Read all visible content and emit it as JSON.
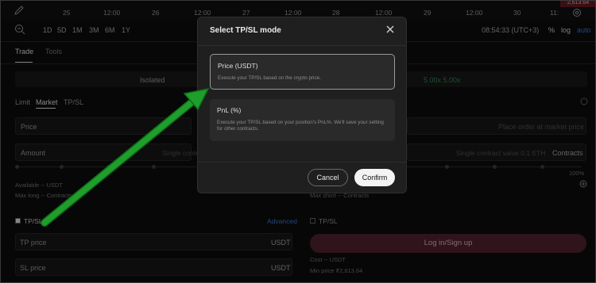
{
  "timeline": {
    "ticks": [
      "25",
      "12:00",
      "26",
      "12:00",
      "27",
      "12:00",
      "28",
      "12:00",
      "29",
      "12:00",
      "30",
      "11:"
    ],
    "price_tag": "2,613.64"
  },
  "toolbar": {
    "timeframes": [
      "1D",
      "5D",
      "1M",
      "3M",
      "6M",
      "1Y"
    ],
    "clock": "08:54:33 (UTC+3)",
    "percent_label": "%",
    "log_label": "log",
    "auto_label": "auto"
  },
  "panel": {
    "tabs": [
      "Trade",
      "Tools"
    ],
    "margin_mode": "Isolated",
    "leverage": "5.00x  5.00x",
    "order_types": [
      "Limit",
      "Market",
      "TP/SL"
    ],
    "price_label": "Price",
    "price_placeholder": "Place order at market price",
    "amount_label": "Amount",
    "amount_placeholder_left": "Single contr",
    "amount_placeholder_right": "Single contract value 0.1 ETH",
    "amount_unit": "Contracts",
    "pct_max": "100%",
    "available": "Available -- USDT",
    "max_long": "Max long -- Contracts",
    "max_short": "Max short -- Contracts",
    "tpsl_label_left": "TP/SL",
    "advanced": "Advanced",
    "tpsl_label_right": "TP/SL",
    "tp_price": "TP price",
    "sl_price": "SL price",
    "unit_usdt": "USDT",
    "login_button": "Log in/Sign up",
    "cost": "Cost -- USDT",
    "min_price": "Min price ₮2,613.64"
  },
  "modal": {
    "title": "Select TP/SL mode",
    "options": [
      {
        "title": "Price (USDT)",
        "desc": "Execute your TP/SL based on the crypto price."
      },
      {
        "title": "PnL (%)",
        "desc": "Execute your TP/SL based on your position's PnL%. We'll save your setting for other contracts."
      }
    ],
    "cancel": "Cancel",
    "confirm": "Confirm",
    "selected_index": 0
  },
  "colors": {
    "annotation_arrow": "#1f9e2c",
    "confirm_bg": "#f3f3f3",
    "login_bg": "#4a1f2a"
  }
}
